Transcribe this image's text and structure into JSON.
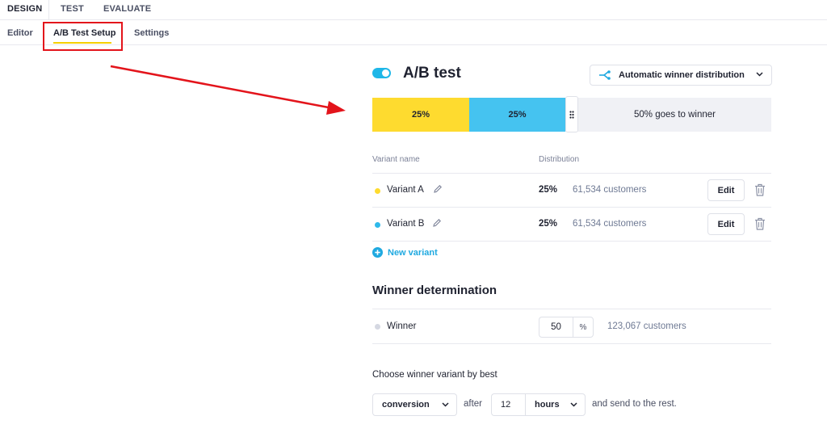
{
  "top_nav": {
    "tabs": [
      "DESIGN",
      "TEST",
      "EVALUATE"
    ],
    "active": "DESIGN"
  },
  "sub_nav": {
    "tabs": [
      "Editor",
      "A/B Test Setup",
      "Settings"
    ],
    "active": "A/B Test Setup"
  },
  "header": {
    "title": "A/B test",
    "toggle_on": true,
    "distribution_mode": "Automatic winner distribution"
  },
  "distribution_bar": {
    "segments": [
      {
        "label": "25%",
        "value": 25,
        "color": "#fedb2f"
      },
      {
        "label": "25%",
        "value": 25,
        "color": "#45c3f0"
      }
    ],
    "winner_label": "50% goes to winner",
    "winner_share": 50
  },
  "table": {
    "headers": {
      "variant": "Variant name",
      "distribution": "Distribution"
    },
    "rows": [
      {
        "name": "Variant A",
        "dot_color": "#fedb2f",
        "pct": "25%",
        "customers": "61,534 customers",
        "edit_label": "Edit"
      },
      {
        "name": "Variant B",
        "dot_color": "#2fb9ea",
        "pct": "25%",
        "customers": "61,534 customers",
        "edit_label": "Edit"
      }
    ],
    "new_variant_label": "New variant"
  },
  "winner": {
    "section_title": "Winner determination",
    "label": "Winner",
    "value": "50",
    "unit": "%",
    "customers": "123,067 customers"
  },
  "choose": {
    "label": "Choose winner variant by best",
    "metric": "conversion",
    "after_label": "after",
    "amount": "12",
    "period": "hours",
    "tail_label": "and send to the rest."
  },
  "colors": {
    "accent": "#1fb7e8",
    "annotation": "#e3141b",
    "active_underline": "#f5d000"
  },
  "icons": [
    "toggle-icon",
    "share-icon",
    "chevron-down-icon",
    "drag-handle-icon",
    "pencil-icon",
    "trash-icon",
    "plus-circle-icon",
    "arrow-annotation"
  ]
}
